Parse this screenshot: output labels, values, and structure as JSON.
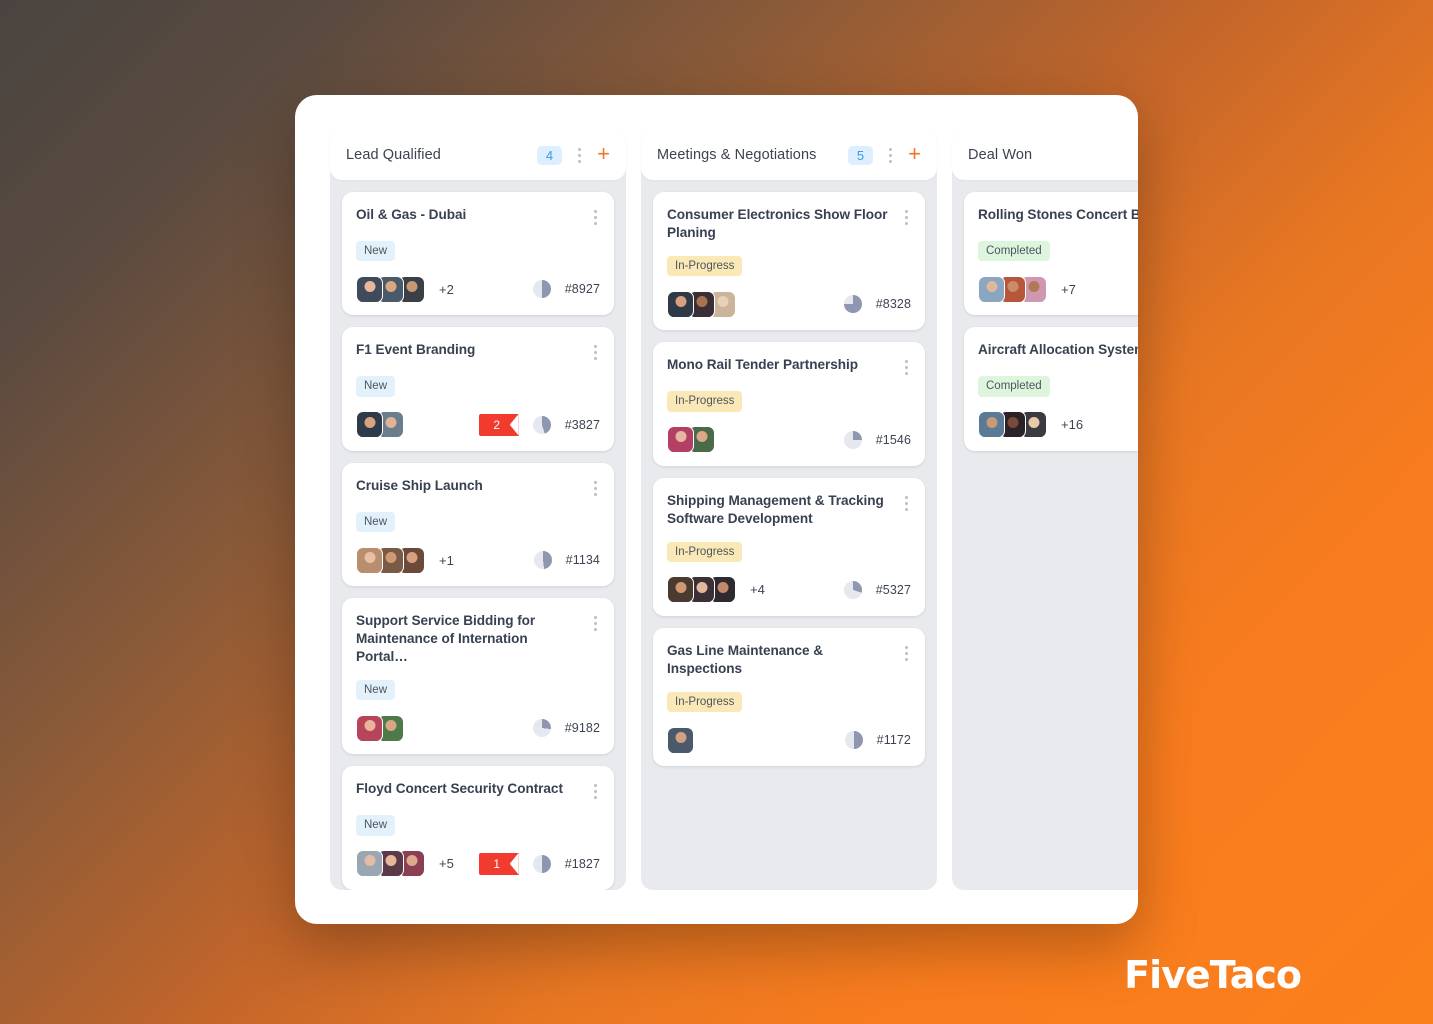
{
  "brand": {
    "name": "FiveTaco"
  },
  "colors": {
    "accent_orange": "#f2762a",
    "count_badge_bg": "#dceeff",
    "count_badge_text": "#3b9ae1",
    "tag_new_bg": "#e3f1fb",
    "tag_inprogress_bg": "#fae9b6",
    "tag_completed_bg": "#ddf5dd",
    "ribbon_red": "#f23b2f",
    "column_bg": "#e8eaed",
    "page_gradient_from": "#4a4440",
    "page_gradient_to": "#fa801c"
  },
  "icons": {
    "kebab": "kebab-menu-icon",
    "plus": "+",
    "pie": "pie-progress-icon"
  },
  "columns": [
    {
      "title": "Lead Qualified",
      "count": "4",
      "add_label": "+",
      "cards": [
        {
          "title": "Oil & Gas - Dubai",
          "tag": "New",
          "tag_type": "new",
          "avatars": [
            "#e7b89c|#3f4a5a",
            "#d9a882|#495a6b",
            "#c79874|#3a3f48"
          ],
          "extra": "+2",
          "flag": null,
          "progress": 50,
          "ticket": "#8927"
        },
        {
          "title": "F1 Event Branding",
          "tag": "New",
          "tag_type": "new",
          "avatars": [
            "#d8a37e|#2f3b4a",
            "#e0b394|#6a7d8c"
          ],
          "extra": null,
          "flag": "2",
          "progress": 45,
          "ticket": "#3827"
        },
        {
          "title": "Cruise Ship Launch",
          "tag": "New",
          "tag_type": "new",
          "avatars": [
            "#e9c0a4|#b98e6e",
            "#cf9a72|#7a5a46",
            "#d7a07e|#6b4a3a"
          ],
          "extra": "+1",
          "flag": null,
          "progress": 48,
          "ticket": "#1134"
        },
        {
          "title": "Support Service Bidding for Maintenance of Internation Portal…",
          "tag": "New",
          "tag_type": "new",
          "avatars": [
            "#e8b49a|#b8445c",
            "#d9a584|#4e7a4a"
          ],
          "extra": null,
          "flag": null,
          "progress": 27,
          "ticket": "#9182"
        },
        {
          "title": "Floyd Concert Security Contract",
          "tag": "New",
          "tag_type": "new",
          "avatars": [
            "#e2bda6|#9aa6b2",
            "#e6b79a|#5a3a46",
            "#dca98c|#8a3f52"
          ],
          "extra": "+5",
          "flag": "1",
          "progress": 50,
          "ticket": "#1827"
        }
      ]
    },
    {
      "title": "Meetings & Negotiations",
      "count": "5",
      "add_label": "+",
      "cards": [
        {
          "title": "Consumer Electronics Show Floor Planing",
          "tag": "In-Progress",
          "tag_type": "inprogress",
          "avatars": [
            "#d7a07e|#2f3a46",
            "#a9734f|#3a2f36",
            "#ead0b4|#cbb59a"
          ],
          "extra": null,
          "flag": null,
          "progress": 75,
          "ticket": "#8328"
        },
        {
          "title": "Mono Rail Tender Partnership",
          "tag": "In-Progress",
          "tag_type": "inprogress",
          "avatars": [
            "#e6b7a0|#b43f64",
            "#dba98a|#4a6a4a"
          ],
          "extra": null,
          "flag": null,
          "progress": 25,
          "ticket": "#1546"
        },
        {
          "title": "Shipping Management & Tracking Software Development",
          "tag": "In-Progress",
          "tag_type": "inprogress",
          "avatars": [
            "#cf9a72|#4a3a30",
            "#e5b89c|#3a3036",
            "#c4886a|#2f2a30"
          ],
          "extra": "+4",
          "flag": null,
          "progress": 30,
          "ticket": "#5327"
        },
        {
          "title": "Gas Line Maintenance & Inspections",
          "tag": "In-Progress",
          "tag_type": "inprogress",
          "avatars": [
            "#d2a184|#4a5a6a"
          ],
          "extra": null,
          "flag": null,
          "progress": 50,
          "ticket": "#1172"
        }
      ]
    },
    {
      "title": "Deal Won",
      "count": "",
      "add_label": "",
      "cards": [
        {
          "title": "Rolling Stones Concert Bo",
          "tag": "Completed",
          "tag_type": "completed",
          "avatars": [
            "#dcb89c|#8aa6c0",
            "#c98e68|#b8563c",
            "#b07a58|#d098b0"
          ],
          "extra": "+7",
          "flag": null,
          "progress": 0,
          "ticket": ""
        },
        {
          "title": "Aircraft Allocation System",
          "tag": "Completed",
          "tag_type": "completed",
          "avatars": [
            "#c99a78|#5a7a96",
            "#7a4a38|#2a2228",
            "#e8c9a8|#3a3a42"
          ],
          "extra": "+16",
          "flag": null,
          "progress": 0,
          "ticket": ""
        }
      ]
    }
  ]
}
